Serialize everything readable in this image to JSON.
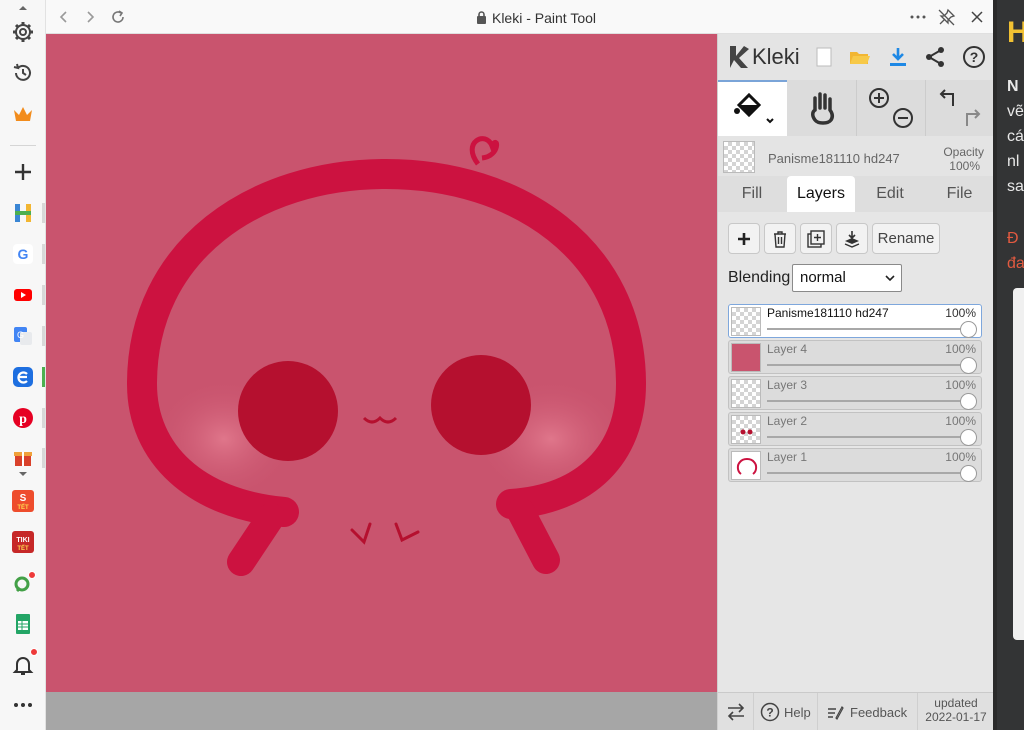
{
  "window": {
    "title": "Kleki - Paint Tool"
  },
  "colors": {
    "canvas_bg": "#c9546e",
    "stroke": "#cc1240",
    "cheek": "#b5102f",
    "panel_bg": "#e4e4e4",
    "accent": "#1e88e5"
  },
  "sidebar": {
    "items": [
      {
        "icon": "gear-icon"
      },
      {
        "icon": "history-icon"
      },
      {
        "icon": "crown-icon"
      },
      {
        "icon": "add-icon"
      },
      {
        "icon": "h-app-icon"
      },
      {
        "icon": "google-icon"
      },
      {
        "icon": "youtube-icon"
      },
      {
        "icon": "translate-icon"
      },
      {
        "icon": "e-app-icon"
      },
      {
        "icon": "pinterest-icon"
      },
      {
        "icon": "gift-icon"
      },
      {
        "icon": "shopee-icon"
      },
      {
        "icon": "tiki-icon"
      },
      {
        "icon": "map-pin-icon"
      },
      {
        "icon": "sheets-icon"
      },
      {
        "icon": "bell-icon"
      },
      {
        "icon": "more-icon"
      }
    ],
    "tiki_badge": "TIKI",
    "tet_label": "TẾT"
  },
  "kleki": {
    "logo_text": "Kleki",
    "active_layer": {
      "name": "Panisme181110 hd247",
      "opacity_label": "Opacity",
      "opacity_value": "100%"
    },
    "tabs": [
      "Fill",
      "Layers",
      "Edit",
      "File"
    ],
    "layer_buttons": {
      "rename": "Rename"
    },
    "blending": {
      "label": "Blending",
      "value": "normal"
    },
    "layers": [
      {
        "name": "Panisme181110 hd247",
        "opacity": "100%"
      },
      {
        "name": "Layer 4",
        "opacity": "100%"
      },
      {
        "name": "Layer 3",
        "opacity": "100%"
      },
      {
        "name": "Layer 2",
        "opacity": "100%"
      },
      {
        "name": "Layer 1",
        "opacity": "100%"
      }
    ],
    "footer": {
      "help": "Help",
      "feedback": "Feedback",
      "updated_label": "updated",
      "updated_date": "2022-01-17"
    }
  },
  "right_page": {
    "logo": "H",
    "lines": [
      "N",
      "vẽ",
      "cá",
      "nl",
      "sa"
    ],
    "red_lines": [
      "Đ",
      "đa"
    ]
  }
}
